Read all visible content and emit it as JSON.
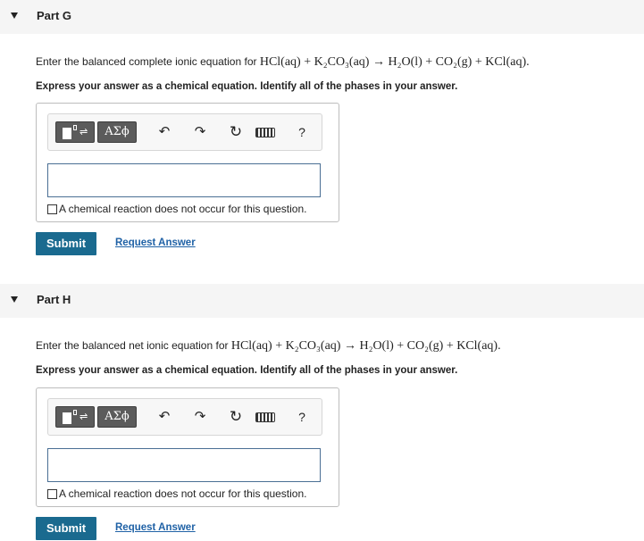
{
  "parts": [
    {
      "title": "Part G",
      "prompt_prefix": "Enter the balanced complete ionic equation for",
      "equation": "HCl(aq) + K₂CO₃(aq) → H₂O(l) + CO₂(g) + KCl(aq).",
      "instruction": "Express your answer as a chemical equation. Identify all of the phases in your answer.",
      "greek_label": "ΑΣϕ",
      "help_label": "?",
      "input_value": "",
      "no_reaction_label": "A chemical reaction does not occur for this question.",
      "submit_label": "Submit",
      "request_label": "Request Answer"
    },
    {
      "title": "Part H",
      "prompt_prefix": "Enter the balanced net ionic equation for",
      "equation": "HCl(aq) + K₂CO₃(aq) → H₂O(l) + CO₂(g) + KCl(aq).",
      "instruction": "Express your answer as a chemical equation. Identify all of the phases in your answer.",
      "greek_label": "ΑΣϕ",
      "help_label": "?",
      "input_value": "",
      "no_reaction_label": "A chemical reaction does not occur for this question.",
      "submit_label": "Submit",
      "request_label": "Request Answer"
    }
  ],
  "colors": {
    "submit_bg": "#1a6a8f",
    "link": "#2062a6",
    "header_bg": "#f5f5f5"
  },
  "icons": [
    "collapse-triangle-icon",
    "templates-icon",
    "undo-icon",
    "redo-icon",
    "reset-icon",
    "keyboard-icon",
    "help-icon"
  ]
}
